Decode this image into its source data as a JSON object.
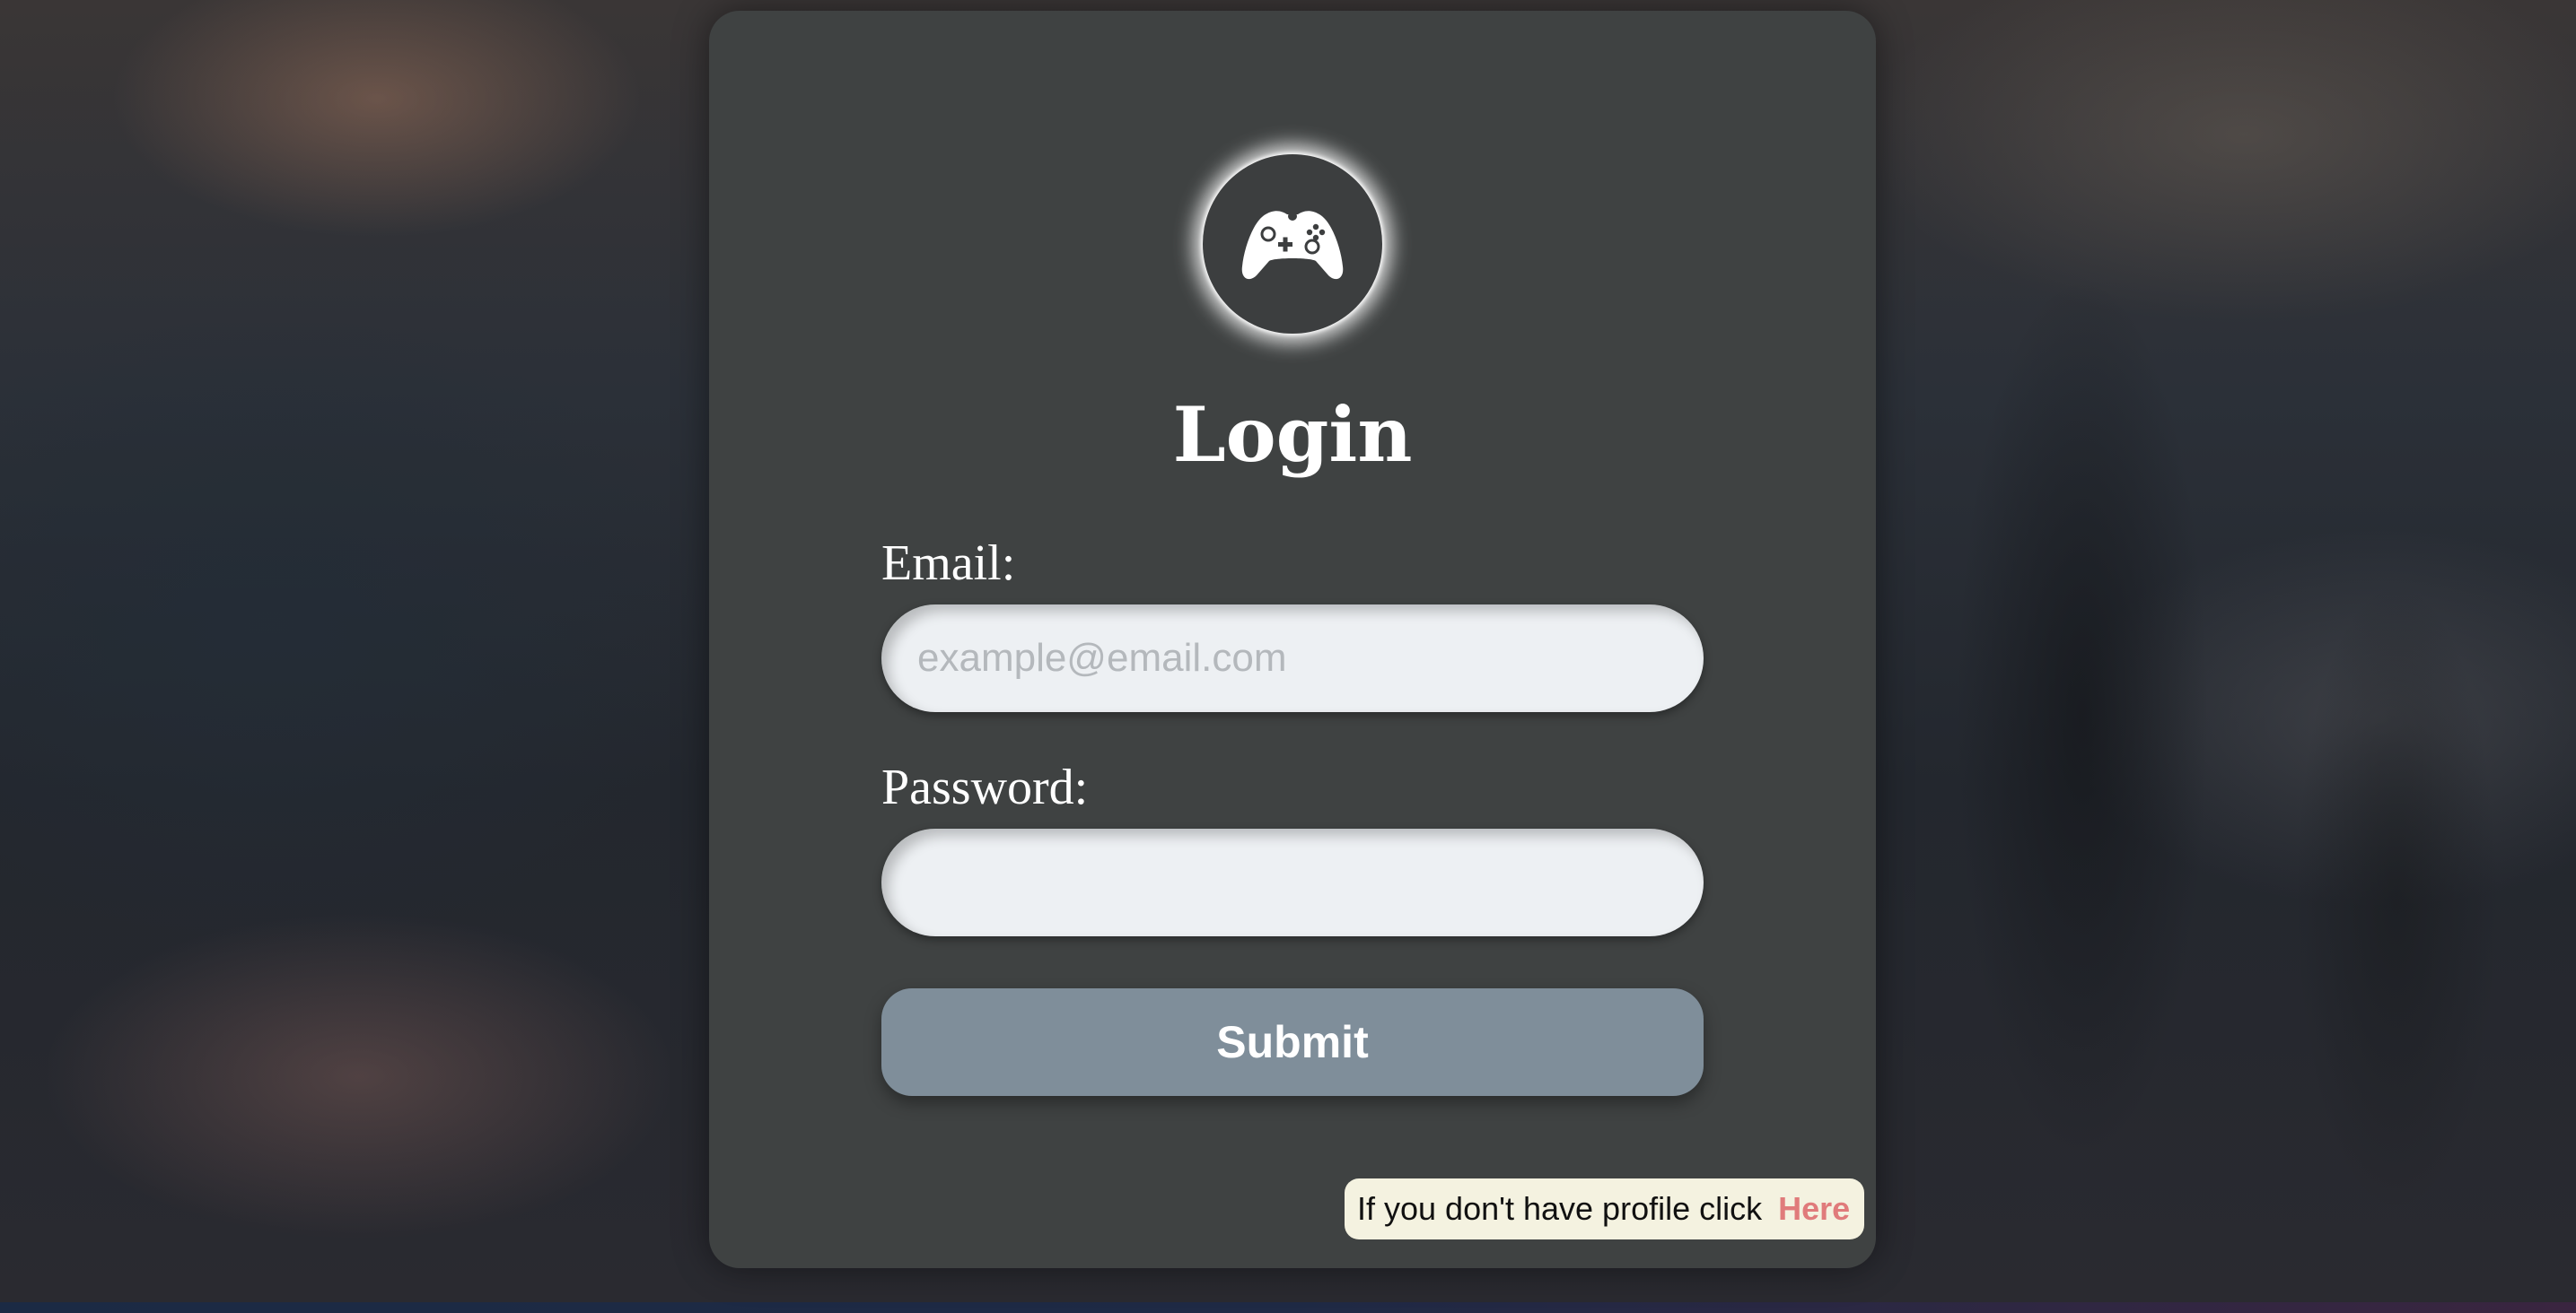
{
  "page": {
    "title": "Login"
  },
  "logo": {
    "icon": "gamepad-icon"
  },
  "form": {
    "email_label": "Email:",
    "email_placeholder": "example@email.com",
    "email_value": "",
    "password_label": "Password:",
    "password_value": "",
    "submit_label": "Submit"
  },
  "signup": {
    "text": "If you don't have profile click",
    "link_label": "Here"
  },
  "colors": {
    "card": "#3f4242",
    "input_bg": "#edf0f3",
    "submit_bg": "#7f8e9a",
    "note_bg": "#f4f2e0",
    "link": "#e07b7b"
  }
}
